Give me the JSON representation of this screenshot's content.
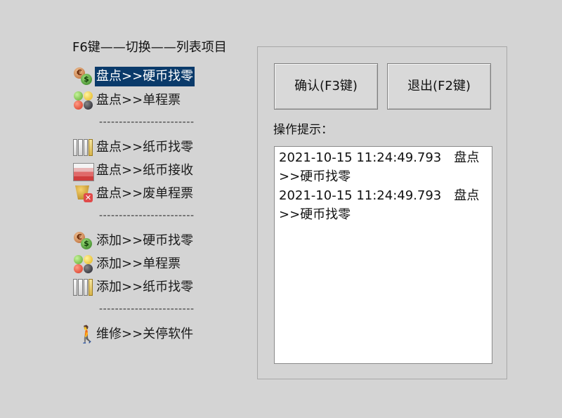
{
  "menu": {
    "header": "F6键——切换——列表项目",
    "items": [
      {
        "label": "盘点>>硬币找零",
        "icon": "coins-icon",
        "selected": true
      },
      {
        "label": "盘点>>单程票",
        "icon": "traffic-dots-icon",
        "selected": false
      },
      {
        "label": "盘点>>纸币找零",
        "icon": "bills-icon",
        "selected": false
      },
      {
        "label": "盘点>>纸币接收",
        "icon": "banknote-stack-icon",
        "selected": false
      },
      {
        "label": "盘点>>废单程票",
        "icon": "discard-ticket-icon",
        "selected": false
      },
      {
        "label": "添加>>硬币找零",
        "icon": "coins-icon",
        "selected": false
      },
      {
        "label": "添加>>单程票",
        "icon": "traffic-dots-icon",
        "selected": false
      },
      {
        "label": "添加>>纸币找零",
        "icon": "bills-icon",
        "selected": false
      },
      {
        "label": "维修>>关停软件",
        "icon": "walking-person-icon",
        "selected": false
      }
    ],
    "separator": "------------------------"
  },
  "panel": {
    "confirm_label": "确认(F3键)",
    "exit_label": "退出(F2键)",
    "hint_label": "操作提示：",
    "log": [
      "2021-10-15 11:24:49.793　盘点>>硬币找零",
      "2021-10-15 11:24:49.793　盘点>>硬币找零"
    ]
  },
  "colors": {
    "background": "#d4d4d4",
    "selection": "#0a3a6a"
  }
}
